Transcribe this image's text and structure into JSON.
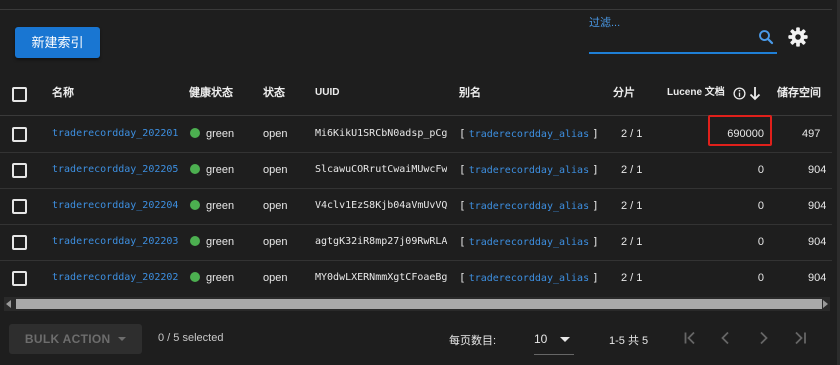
{
  "toolbar": {
    "new_index_label": "新建索引",
    "filter_placeholder": "过滤..."
  },
  "table": {
    "headers": {
      "name": "名称",
      "health": "健康状态",
      "status": "状态",
      "uuid": "UUID",
      "alias": "别名",
      "shards": "分片",
      "lucene_docs": "Lucene 文档",
      "storage": "储存空间"
    },
    "rows": [
      {
        "name": "traderecordday_202201",
        "health": "green",
        "status": "open",
        "uuid": "Mi6KikU1SRCbN0adsp_pCg",
        "alias": "traderecordday_alias",
        "shards": "2 / 1",
        "docs": "690000",
        "storage": "497"
      },
      {
        "name": "traderecordday_202205",
        "health": "green",
        "status": "open",
        "uuid": "SlcawuCORrutCwaiMUwcFw",
        "alias": "traderecordday_alias",
        "shards": "2 / 1",
        "docs": "0",
        "storage": "904"
      },
      {
        "name": "traderecordday_202204",
        "health": "green",
        "status": "open",
        "uuid": "V4clv1EzS8Kjb04aVmUvVQ",
        "alias": "traderecordday_alias",
        "shards": "2 / 1",
        "docs": "0",
        "storage": "904"
      },
      {
        "name": "traderecordday_202203",
        "health": "green",
        "status": "open",
        "uuid": "agtgK32iR8mp27j09RwRLA",
        "alias": "traderecordday_alias",
        "shards": "2 / 1",
        "docs": "0",
        "storage": "904"
      },
      {
        "name": "traderecordday_202202",
        "health": "green",
        "status": "open",
        "uuid": "MY0dwLXERNmmXgtCFoaeBg",
        "alias": "traderecordday_alias",
        "shards": "2 / 1",
        "docs": "0",
        "storage": "904"
      }
    ],
    "bracket_open": "[",
    "bracket_close": "]"
  },
  "footer": {
    "bulk_action_label": "BULK ACTION",
    "selected_text": "0 / 5 selected",
    "per_page_label": "每页数目:",
    "per_page_value": "10",
    "range_text": "1-5 共 5"
  },
  "colors": {
    "accent": "#1976d2",
    "health_green": "#4caf50",
    "highlight_red": "#e0201b"
  }
}
